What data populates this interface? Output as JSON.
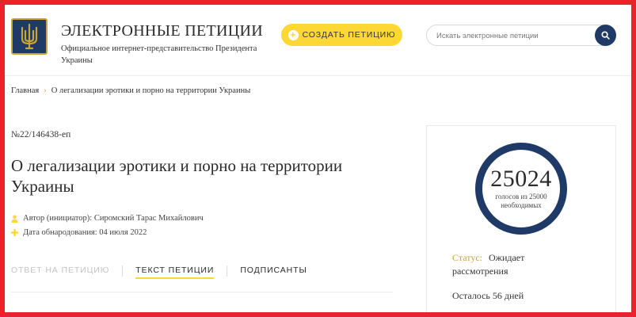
{
  "header": {
    "title": "ЭЛЕКТРОННЫЕ ПЕТИЦИИ",
    "subtitle": "Официальное интернет-представительство Президента Украины",
    "create_button": "СОЗДАТЬ ПЕТИЦИЮ",
    "search_placeholder": "Искать электронные петиции"
  },
  "breadcrumb": {
    "home": "Главная",
    "current": "О легализации эротики и порно на территории Украины"
  },
  "petition": {
    "number": "№22/146438-еп",
    "title": "О легализации эротики и порно на территории Украины",
    "author": "Автор (инициатор): Сиромский Тарас Михайлович",
    "date": "Дата обнародования: 04 июля 2022"
  },
  "tabs": [
    {
      "label": "ОТВЕТ НА ПЕТИЦИЮ"
    },
    {
      "label": "ТЕКСТ ПЕТИЦИИ"
    },
    {
      "label": "ПОДПИСАНТЫ"
    }
  ],
  "sidebar": {
    "votes": "25024",
    "votes_sub": "голосов из 25000 необходимых",
    "status_label": "Статус:",
    "status_value": "Ожидает рассмотрения",
    "remaining": "Осталось 56 дней"
  },
  "colors": {
    "frame": "#e8232b",
    "navy": "#1f3a66",
    "accent_yellow": "#fdd835",
    "gold": "#c9a43a"
  }
}
